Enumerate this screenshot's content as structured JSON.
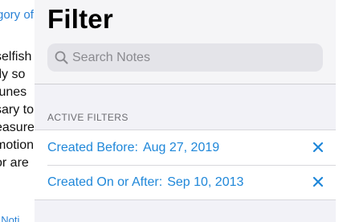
{
  "background_note": {
    "link_fragment": "gory of",
    "text_fragments": [
      "selfish",
      "tly so",
      "tunes",
      "sary to",
      "easure",
      "motion",
      "or are"
    ],
    "footer_fragment": "f Noti"
  },
  "popover": {
    "title": "Filter",
    "search": {
      "placeholder": "Search Notes",
      "value": "",
      "icon": "magnifying-glass"
    },
    "section_header": "ACTIVE FILTERS",
    "filters": [
      {
        "label": "Created Before:",
        "value": "Aug 27, 2019",
        "remove_icon": "x-mark"
      },
      {
        "label": "Created On or After:",
        "value": "Sep 10, 2013",
        "remove_icon": "x-mark"
      }
    ]
  },
  "colors": {
    "accent": "#1f87d9",
    "popover_bg": "#f2f2f7",
    "search_field_bg": "#e4e4e9",
    "secondary_text": "#6d6d72"
  }
}
